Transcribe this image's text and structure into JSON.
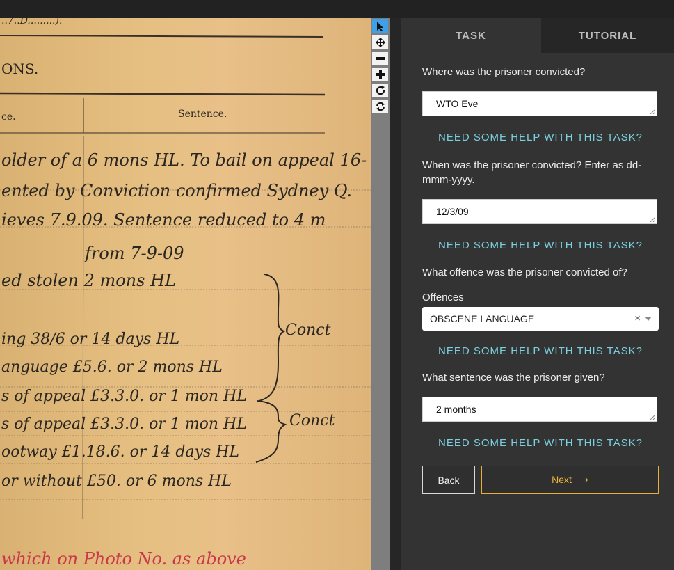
{
  "document": {
    "fragments": [
      "..7..D.........).",
      "ONS.",
      "ce.",
      "Sentence."
    ],
    "lines": [
      "older of a   6 mons HL. To bail on appeal 16-",
      "ented by   Conviction confirmed Sydney Q.",
      "ieves   7.9.09. Sentence reduced to 4 m",
      "from 7-9-09",
      "ed stolen   2 mons HL",
      "ing   38/6 or 14 days HL",
      "anguage   £5.6. or 2 mons HL",
      "s of appeal  £3.3.0. or 1 mon HL",
      "s of appeal  £3.3.0. or 1 mon HL",
      "ootway   £1.18.6. or 14 days HL",
      "or without  £50. or 6 mons HL"
    ],
    "braces": [
      "Conct",
      "Conct"
    ],
    "footer": "which on Photo No. as above"
  },
  "tools": [
    "pointer-icon",
    "move-icon",
    "zoom-out-icon",
    "zoom-in-icon",
    "rotate-icon",
    "reset-icon"
  ],
  "tabs": {
    "task": "TASK",
    "tutorial": "TUTORIAL"
  },
  "form": {
    "q1": "Where was the prisoner convicted?",
    "a1": "WTO Eve",
    "help": "NEED SOME HELP WITH THIS TASK?",
    "q2": "When was the prisoner convicted? Enter as dd-mmm-yyyy.",
    "a2": "12/3/09",
    "q3": "What offence was the prisoner convicted of?",
    "offences_label": "Offences",
    "offence_value": "OBSCENE LANGUAGE",
    "clear": "×",
    "q4": "What sentence was the prisoner given?",
    "a4": "2 months"
  },
  "buttons": {
    "back": "Back",
    "next": "Next ⟶"
  },
  "colors": {
    "help": "#7ad0df",
    "next": "#f0b63a",
    "active_tool": "#3ea0e8"
  }
}
